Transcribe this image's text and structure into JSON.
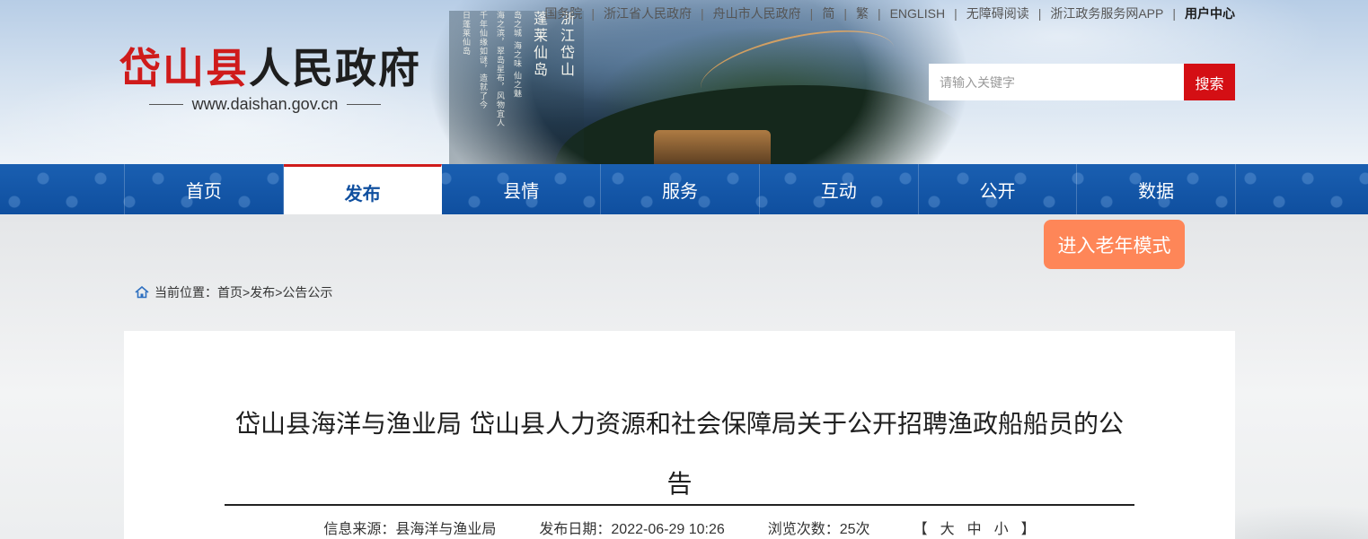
{
  "site": {
    "title_red": "岱山县",
    "title_rest": "人民政府",
    "domain": "www.daishan.gov.cn"
  },
  "hero": {
    "poem_big_1": "蓬莱仙岛",
    "poem_big_2": "浙江岱山",
    "poem_small_1": "岛之城 海之味 仙之魅",
    "poem_small_2": "海之滨，翠岛星布，风物宜人",
    "poem_small_3": "千年仙缘如谜，造就了今",
    "poem_small_4": "日蓬莱仙岛"
  },
  "top_links": [
    {
      "label": "国务院"
    },
    {
      "label": "浙江省人民政府"
    },
    {
      "label": "舟山市人民政府"
    },
    {
      "label": "简"
    },
    {
      "label": "繁"
    },
    {
      "label": "ENGLISH"
    },
    {
      "label": "无障碍阅读"
    },
    {
      "label": "浙江政务服务网APP"
    },
    {
      "label": "用户中心"
    }
  ],
  "search": {
    "placeholder": "请输入关键字",
    "button_label": "搜索"
  },
  "nav": [
    {
      "label": "首页",
      "active": false
    },
    {
      "label": "发布",
      "active": true
    },
    {
      "label": "县情",
      "active": false
    },
    {
      "label": "服务",
      "active": false
    },
    {
      "label": "互动",
      "active": false
    },
    {
      "label": "公开",
      "active": false
    },
    {
      "label": "数据",
      "active": false
    }
  ],
  "elder_mode": {
    "label": "进入老年模式"
  },
  "breadcrumb": {
    "prefix": "当前位置：",
    "items": [
      "首页",
      "发布",
      "公告公示"
    ],
    "separator": ">"
  },
  "article": {
    "title": "岱山县海洋与渔业局 岱山县人力资源和社会保障局关于公开招聘渔政船船员的公告",
    "source_label": "信息来源：",
    "source_value": "县海洋与渔业局",
    "date_label": "发布日期：",
    "date_value": "2022-06-29 10:26",
    "views_label": "浏览次数：",
    "views_value": "25次",
    "font_size": {
      "open": "【",
      "large": "大",
      "medium": "中",
      "small": "小",
      "close": "】"
    }
  },
  "colors": {
    "brand_red": "#d40f14",
    "nav_blue": "#0f4f9f",
    "elder_orange": "#fe8658"
  },
  "icons": {
    "breadcrumb": "home-icon"
  }
}
